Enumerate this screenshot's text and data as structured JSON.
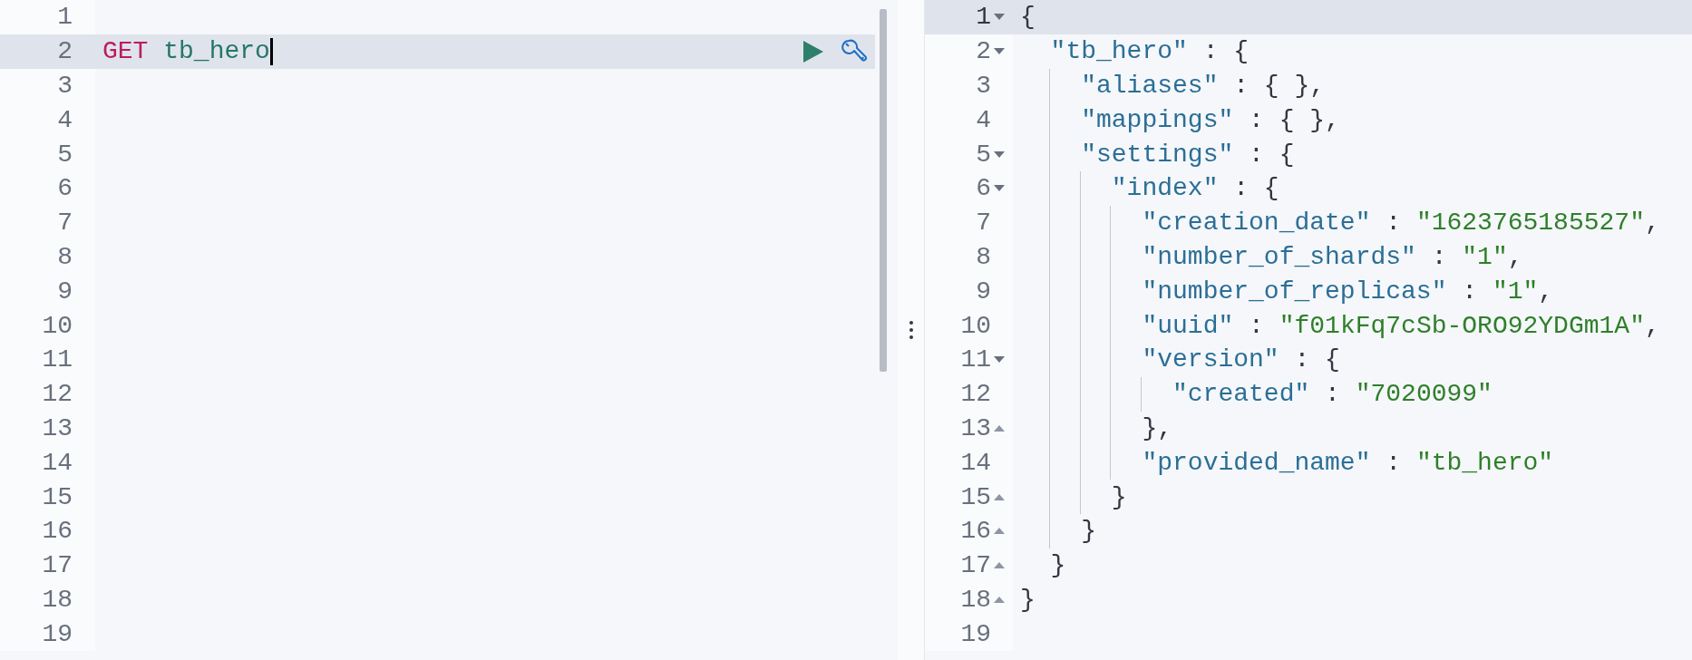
{
  "request_editor": {
    "lines": [
      {
        "number": "1",
        "active": false
      },
      {
        "number": "2",
        "active": true,
        "tokens": [
          {
            "kind": "method",
            "text": "GET"
          },
          {
            "kind": "url",
            "text": "tb_hero"
          }
        ]
      },
      {
        "number": "3",
        "active": false
      },
      {
        "number": "4",
        "active": false
      },
      {
        "number": "5",
        "active": false
      },
      {
        "number": "6",
        "active": false
      },
      {
        "number": "7",
        "active": false
      },
      {
        "number": "8",
        "active": false
      },
      {
        "number": "9",
        "active": false
      },
      {
        "number": "10",
        "active": false
      },
      {
        "number": "11",
        "active": false
      },
      {
        "number": "12",
        "active": false
      },
      {
        "number": "13",
        "active": false
      },
      {
        "number": "14",
        "active": false
      },
      {
        "number": "15",
        "active": false
      },
      {
        "number": "16",
        "active": false
      },
      {
        "number": "17",
        "active": false
      },
      {
        "number": "18",
        "active": false
      },
      {
        "number": "19",
        "active": false
      }
    ]
  },
  "response_viewer": {
    "lines": [
      {
        "number": "1",
        "active": true,
        "fold_start": true,
        "fold_end": false,
        "tokens": [
          {
            "kind": "punct",
            "text": "{"
          }
        ],
        "children": [
          {
            "number": "2",
            "active": false,
            "fold_start": true,
            "fold_end": false,
            "tokens": [
              {
                "kind": "key",
                "text": "\"tb_hero\""
              },
              {
                "kind": "punct",
                "text": " : {"
              }
            ],
            "children": [
              {
                "number": "3",
                "active": false,
                "fold_start": false,
                "fold_end": false,
                "tokens": [
                  {
                    "kind": "key",
                    "text": "\"aliases\""
                  },
                  {
                    "kind": "punct",
                    "text": " : { },"
                  }
                ]
              },
              {
                "number": "4",
                "active": false,
                "fold_start": false,
                "fold_end": false,
                "tokens": [
                  {
                    "kind": "key",
                    "text": "\"mappings\""
                  },
                  {
                    "kind": "punct",
                    "text": " : { },"
                  }
                ]
              },
              {
                "number": "5",
                "active": false,
                "fold_start": true,
                "fold_end": false,
                "tokens": [
                  {
                    "kind": "key",
                    "text": "\"settings\""
                  },
                  {
                    "kind": "punct",
                    "text": " : {"
                  }
                ],
                "children": [
                  {
                    "number": "6",
                    "active": false,
                    "fold_start": true,
                    "fold_end": false,
                    "tokens": [
                      {
                        "kind": "key",
                        "text": "\"index\""
                      },
                      {
                        "kind": "punct",
                        "text": " : {"
                      }
                    ],
                    "children": [
                      {
                        "number": "7",
                        "active": false,
                        "fold_start": false,
                        "fold_end": false,
                        "tokens": [
                          {
                            "kind": "key",
                            "text": "\"creation_date\""
                          },
                          {
                            "kind": "punct",
                            "text": " : "
                          },
                          {
                            "kind": "string",
                            "text": "\"1623765185527\""
                          },
                          {
                            "kind": "punct",
                            "text": ","
                          }
                        ]
                      },
                      {
                        "number": "8",
                        "active": false,
                        "fold_start": false,
                        "fold_end": false,
                        "tokens": [
                          {
                            "kind": "key",
                            "text": "\"number_of_shards\""
                          },
                          {
                            "kind": "punct",
                            "text": " : "
                          },
                          {
                            "kind": "string",
                            "text": "\"1\""
                          },
                          {
                            "kind": "punct",
                            "text": ","
                          }
                        ]
                      },
                      {
                        "number": "9",
                        "active": false,
                        "fold_start": false,
                        "fold_end": false,
                        "tokens": [
                          {
                            "kind": "key",
                            "text": "\"number_of_replicas\""
                          },
                          {
                            "kind": "punct",
                            "text": " : "
                          },
                          {
                            "kind": "string",
                            "text": "\"1\""
                          },
                          {
                            "kind": "punct",
                            "text": ","
                          }
                        ]
                      },
                      {
                        "number": "10",
                        "active": false,
                        "fold_start": false,
                        "fold_end": false,
                        "tokens": [
                          {
                            "kind": "key",
                            "text": "\"uuid\""
                          },
                          {
                            "kind": "punct",
                            "text": " : "
                          },
                          {
                            "kind": "string",
                            "text": "\"f01kFq7cSb-ORO92YDGm1A\""
                          },
                          {
                            "kind": "punct",
                            "text": ","
                          }
                        ]
                      },
                      {
                        "number": "11",
                        "active": false,
                        "fold_start": true,
                        "fold_end": false,
                        "tokens": [
                          {
                            "kind": "key",
                            "text": "\"version\""
                          },
                          {
                            "kind": "punct",
                            "text": " : {"
                          }
                        ],
                        "children": [
                          {
                            "number": "12",
                            "active": false,
                            "fold_start": false,
                            "fold_end": false,
                            "tokens": [
                              {
                                "kind": "key",
                                "text": "\"created\""
                              },
                              {
                                "kind": "punct",
                                "text": " : "
                              },
                              {
                                "kind": "string",
                                "text": "\"7020099\""
                              }
                            ]
                          }
                        ]
                      },
                      {
                        "number": "13",
                        "active": false,
                        "fold_start": false,
                        "fold_end": true,
                        "tokens": [
                          {
                            "kind": "punct",
                            "text": "},"
                          }
                        ]
                      },
                      {
                        "number": "14",
                        "active": false,
                        "fold_start": false,
                        "fold_end": false,
                        "tokens": [
                          {
                            "kind": "key",
                            "text": "\"provided_name\""
                          },
                          {
                            "kind": "punct",
                            "text": " : "
                          },
                          {
                            "kind": "string",
                            "text": "\"tb_hero\""
                          }
                        ]
                      }
                    ]
                  },
                  {
                    "number": "15",
                    "active": false,
                    "fold_start": false,
                    "fold_end": true,
                    "tokens": [
                      {
                        "kind": "punct",
                        "text": "}"
                      }
                    ]
                  }
                ]
              },
              {
                "number": "16",
                "active": false,
                "fold_start": false,
                "fold_end": true,
                "tokens": [
                  {
                    "kind": "punct",
                    "text": "}"
                  }
                ]
              }
            ]
          },
          {
            "number": "17",
            "active": false,
            "fold_start": false,
            "fold_end": true,
            "tokens": [
              {
                "kind": "punct",
                "text": "}"
              }
            ]
          }
        ]
      },
      {
        "number": "18",
        "active": false,
        "fold_start": false,
        "fold_end": true,
        "tokens": [
          {
            "kind": "punct",
            "text": "}"
          }
        ]
      },
      {
        "number": "19",
        "active": false,
        "fold_start": false,
        "fold_end": false
      }
    ]
  }
}
